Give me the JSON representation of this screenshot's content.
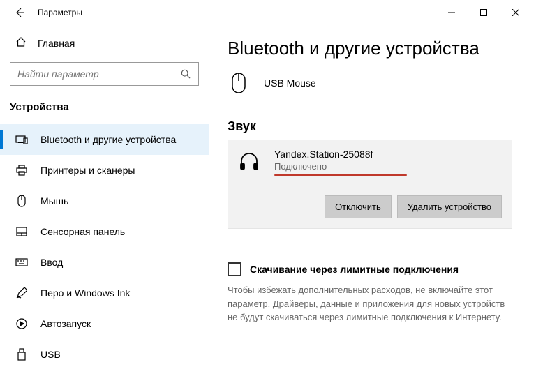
{
  "window": {
    "title": "Параметры"
  },
  "sidebar": {
    "home": "Главная",
    "search_placeholder": "Найти параметр",
    "category": "Устройства",
    "items": [
      {
        "label": "Bluetooth и другие устройства"
      },
      {
        "label": "Принтеры и сканеры"
      },
      {
        "label": "Мышь"
      },
      {
        "label": "Сенсорная панель"
      },
      {
        "label": "Ввод"
      },
      {
        "label": "Перо и Windows Ink"
      },
      {
        "label": "Автозапуск"
      },
      {
        "label": "USB"
      }
    ]
  },
  "main": {
    "title": "Bluetooth и другие устройства",
    "usb_device": "USB Mouse",
    "audio_heading": "Звук",
    "audio_device": {
      "name": "Yandex.Station-25088f",
      "status": "Подключено"
    },
    "buttons": {
      "disconnect": "Отключить",
      "remove": "Удалить устройство"
    },
    "metered": {
      "label": "Скачивание через лимитные подключения",
      "help": "Чтобы избежать дополнительных расходов, не включайте этот параметр. Драйверы, данные и приложения для новых устройств не будут скачиваться через лимитные подключения к Интернету."
    }
  }
}
